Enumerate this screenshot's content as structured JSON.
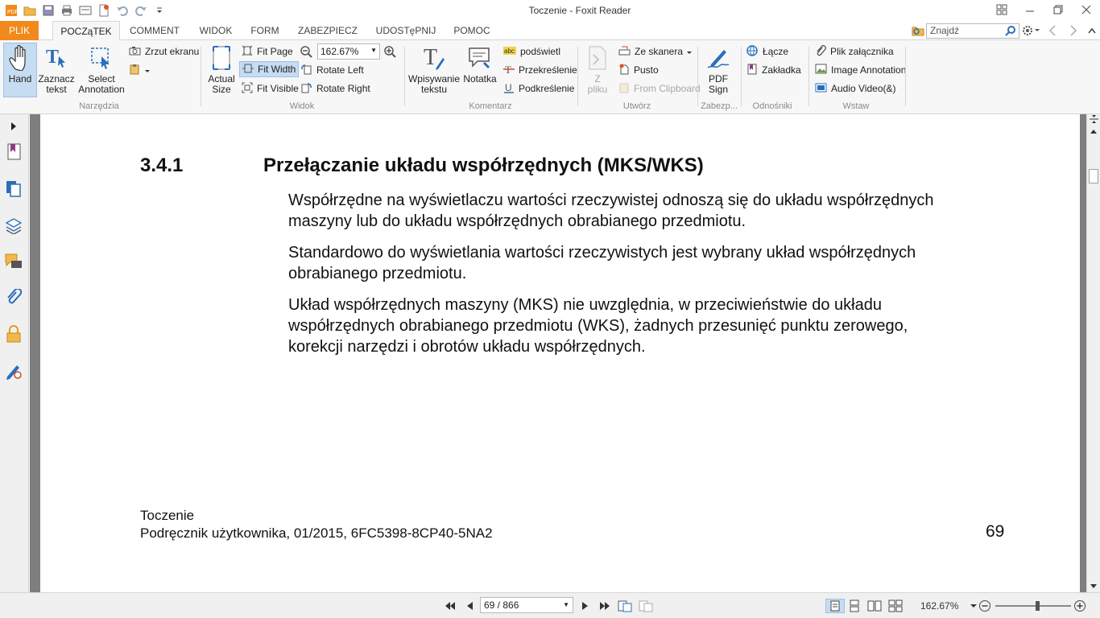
{
  "window": {
    "title": "Toczenie - Foxit Reader"
  },
  "tabs": {
    "file": "PLIK",
    "home": "POCZąTEK",
    "comment": "COMMENT",
    "view": "WIDOK",
    "form": "FORM",
    "protect": "ZABEZPIECZ",
    "share": "UDOSTęPNIJ",
    "help": "POMOC"
  },
  "search": {
    "placeholder": "Znajdź"
  },
  "ribbon": {
    "tools": {
      "hand": "Hand",
      "select_text_1": "Zaznacz",
      "select_text_2": "tekst",
      "select_annot_1": "Select",
      "select_annot_2": "Annotation",
      "snapshot": "Zrzut ekranu",
      "group": "Narzędzia"
    },
    "view": {
      "actual_1": "Actual",
      "actual_2": "Size",
      "fit_page": "Fit Page",
      "fit_width": "Fit Width",
      "fit_visible": "Fit Visible",
      "zoom": "162.67%",
      "rotate_left": "Rotate Left",
      "rotate_right": "Rotate Right",
      "group": "Widok"
    },
    "comment": {
      "typewriter_1": "Wpisywanie",
      "typewriter_2": "tekstu",
      "note": "Notatka",
      "highlight": "podświetl",
      "strikeout": "Przekreślenie",
      "underline": "Podkreślenie",
      "group": "Komentarz"
    },
    "create": {
      "from_file_1": "Z",
      "from_file_2": "pliku",
      "scanner": "Ze skanera",
      "blank": "Pusto",
      "clipboard": "From Clipboard",
      "group": "Utwórz"
    },
    "protect": {
      "pdfsign_1": "PDF",
      "pdfsign_2": "Sign",
      "group": "Zabezp..."
    },
    "links": {
      "link": "Łącze",
      "bookmark": "Zakładka",
      "group": "Odnośniki"
    },
    "insert": {
      "attachment": "Plik załącznika",
      "image": "Image Annotation",
      "audio": "Audio  Video(&)",
      "group": "Wstaw"
    }
  },
  "document": {
    "section_number": "3.4.1",
    "section_title": "Przełączanie układu współrzędnych (MKS/WKS)",
    "p1_line1": "Współrzędne na wyświetlaczu wartości rzeczywistej odnoszą się do układu współrzędnych",
    "p1_line2": "maszyny lub do układu współrzędnych obrabianego przedmiotu.",
    "p2_line1": "Standardowo do wyświetlania wartości rzeczywistych jest wybrany układ współrzędnych",
    "p2_line2": "obrabianego przedmiotu.",
    "p3_line1": "Układ współrzędnych maszyny (MKS) nie uwzględnia, w przeciwieństwie do układu",
    "p3_line2": "współrzędnych obrabianego przedmiotu (WKS), żadnych przesunięć punktu zerowego,",
    "p3_line3": "korekcji narzędzi i obrotów układu współrzędnych.",
    "footer_title": "Toczenie",
    "footer_info": "Podręcznik użytkownika, 01/2015, 6FC5398-8CP40-5NA2",
    "page_number": "69"
  },
  "statusbar": {
    "page_indicator": "69 / 866",
    "zoom": "162.67%",
    "zoom_slider_fraction": 0.55
  }
}
